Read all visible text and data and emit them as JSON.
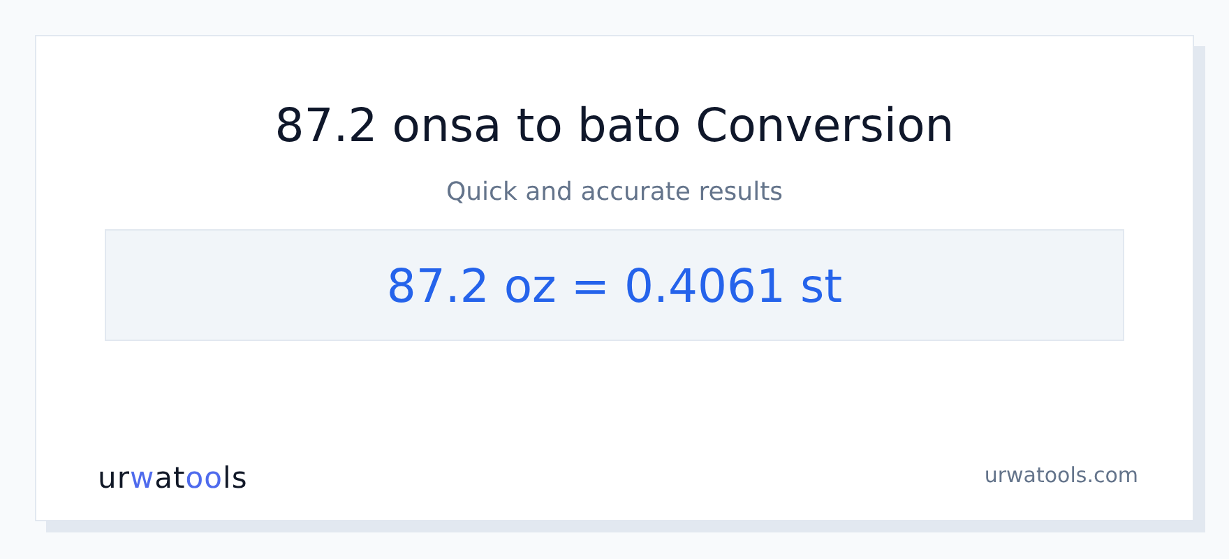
{
  "title": "87.2 onsa to bato Conversion",
  "subtitle": "Quick and accurate results",
  "result": "87.2 oz = 0.4061 st",
  "footer": {
    "logo": "urwatools",
    "site": "urwatools.com"
  }
}
